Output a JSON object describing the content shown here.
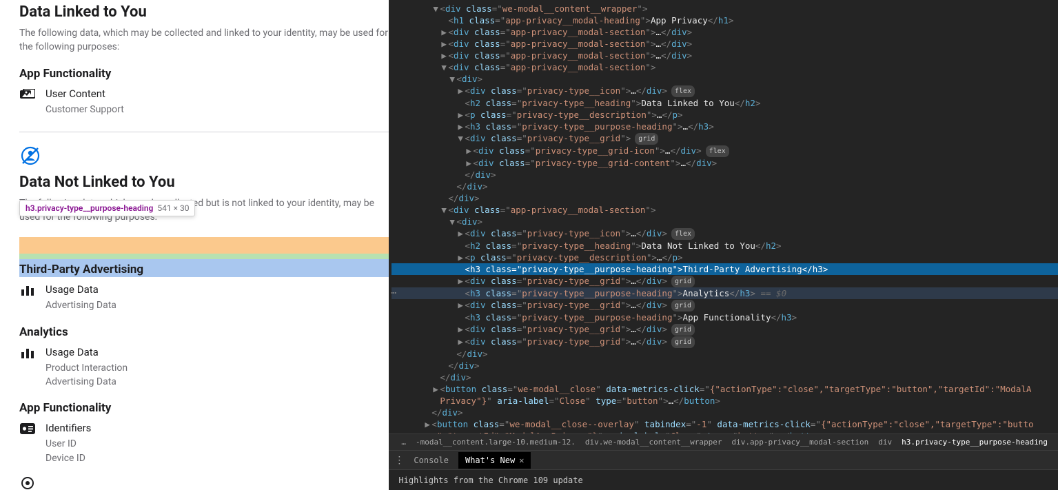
{
  "tooltip": {
    "selector": "h3.privacy-type__purpose-heading",
    "dims": "541 × 30"
  },
  "privacy": {
    "section_linked": {
      "heading": "Data Linked to You",
      "desc": "The following data, which may be collected and linked to your identity, may be used for the following purposes:",
      "purpose1": "App Functionality",
      "item1_title": "User Content",
      "item1_sub": "Customer Support"
    },
    "section_notlinked": {
      "heading": "Data Not Linked to You",
      "desc": "The following data, which may be collected but is not linked to your identity, may be used for the following purposes:",
      "purpose1": "Third-Party Advertising",
      "p1_item1_title": "Usage Data",
      "p1_item1_sub": "Advertising Data",
      "purpose2": "Analytics",
      "p2_item1_title": "Usage Data",
      "p2_item1_sub1": "Product Interaction",
      "p2_item1_sub2": "Advertising Data",
      "purpose3": "App Functionality",
      "p3_item1_title": "Identifiers",
      "p3_item1_sub1": "User ID",
      "p3_item1_sub2": "Device ID"
    }
  },
  "dom": {
    "l1": "<div class=\"we-modal__content__wrapper\">",
    "l2": "<h1 class=\"app-privacy__modal-heading\">",
    "l2t": "App Privacy",
    "l2c": "</h1>",
    "l3": "<div class=\"app-privacy__modal-section\">",
    "l3e": "…",
    "l3c": "</div>",
    "l6": "<div class=\"app-privacy__modal-section\">",
    "l7": "<div>",
    "l8": "<div class=\"privacy-type__icon\">",
    "l9": "<h2 class=\"privacy-type__heading\">",
    "l9t": "Data Linked to You",
    "l9c": "</h2>",
    "l10": "<p class=\"privacy-type__description\">",
    "l10c": "</p>",
    "l11": "<h3 class=\"privacy-type__purpose-heading\">",
    "l11c": "</h3>",
    "l12": "<div class=\"privacy-type__grid\">",
    "l13": "<div class=\"privacy-type__grid-icon\">",
    "l14": "<div class=\"privacy-type__grid-content\">",
    "cdiv": "</div>",
    "l20t": "Data Not Linked to You",
    "l22t": "Third-Party Advertising",
    "l23t": "Analytics",
    "l24t": "App Functionality",
    "btn1a": "<button class=\"we-modal__close\" data-metrics-click=\"{\"actionType\":\"close\",\"targetType\":\"button\",\"targetId\":\"ModalA",
    "btn1b": "Privacy\"}\" aria-label=\"Close\" type=\"button\">",
    "btn1c": "</button>",
    "btn2a": "<button class=\"we-modal__close--overlay\" tabindex=\"-1\" data-metrics-click=\"{\"actionType\":\"close\",\"targetType\":\"butto",
    "btn2b": "n\",\"targetId\":\"ModalAppPrivacy\"}\" aria-label=\"Close\" type=\"button\">",
    "eq0": " == $0",
    "badge_flex": "flex",
    "badge_grid": "grid"
  },
  "crumbs": {
    "dots": "…",
    "c1": "-modal__content.large-10.medium-12.",
    "c2": "div.we-modal__content__wrapper",
    "c3": "div.app-privacy__modal-section",
    "c4": "div",
    "c5": "h3.privacy-type__purpose-heading"
  },
  "drawer": {
    "tab1": "Console",
    "tab2": "What's New",
    "body": "Highlights from the Chrome 109 update"
  }
}
